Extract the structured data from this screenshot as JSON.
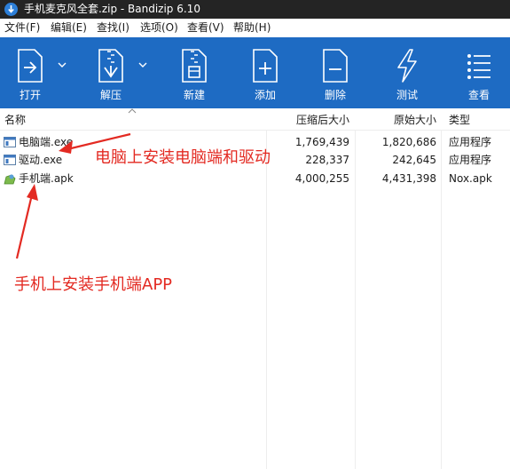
{
  "window": {
    "title": "手机麦克风全套.zip - Bandizip 6.10"
  },
  "menu": [
    {
      "label": "文件(F)"
    },
    {
      "label": "编辑(E)"
    },
    {
      "label": "查找(I)"
    },
    {
      "label": "选项(O)"
    },
    {
      "label": "查看(V)"
    },
    {
      "label": "帮助(H)"
    }
  ],
  "toolbar": {
    "open": "打开",
    "extract": "解压",
    "new": "新建",
    "add": "添加",
    "delete": "删除",
    "test": "测试",
    "view": "查看"
  },
  "columns": {
    "name": "名称",
    "compressed": "压缩后大小",
    "original": "原始大小",
    "type": "类型"
  },
  "files": [
    {
      "name": "电脑端.exe",
      "compressed": "1,769,439",
      "original": "1,820,686",
      "type": "应用程序",
      "icon": "exe-file-icon"
    },
    {
      "name": "驱动.exe",
      "compressed": "228,337",
      "original": "242,645",
      "type": "应用程序",
      "icon": "exe-file-icon"
    },
    {
      "name": "手机端.apk",
      "compressed": "4,000,255",
      "original": "4,431,398",
      "type": "Nox.apk",
      "icon": "apk-file-icon"
    }
  ],
  "annotations": {
    "pc": "电脑上安装电脑端和驱动",
    "phone": "手机上安装手机端APP"
  },
  "colors": {
    "toolbar_bg": "#1e6bc3",
    "titlebar_bg": "#242424",
    "annotation": "#e32a22"
  }
}
